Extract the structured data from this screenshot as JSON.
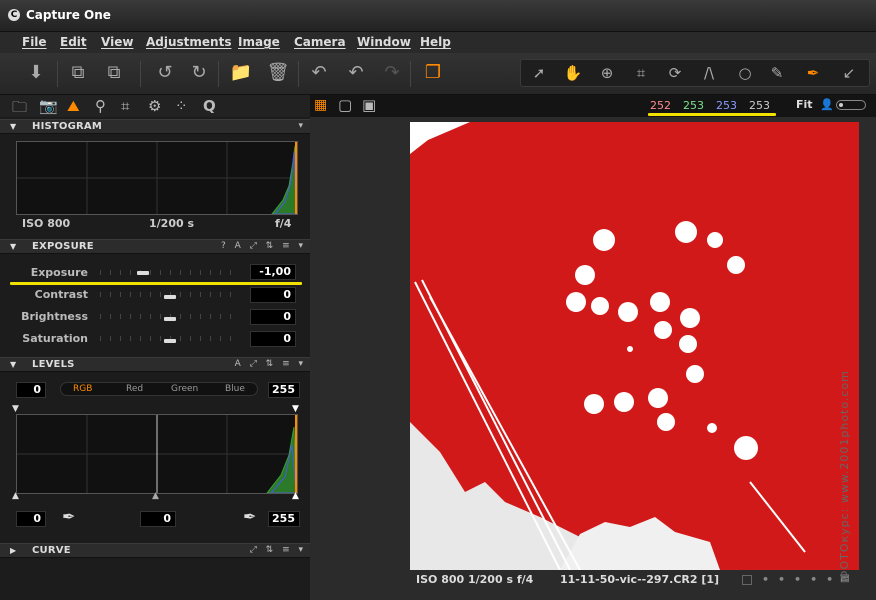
{
  "app": {
    "title": "Capture One",
    "logo_glyph": "C"
  },
  "menu": [
    "File",
    "Edit",
    "View",
    "Adjustments",
    "Image",
    "Camera",
    "Window",
    "Help"
  ],
  "toolbar": {
    "icons": [
      "import-icon",
      "compare-icon",
      "next-icon",
      "rotate-left-icon",
      "rotate-right-icon",
      "move-to-icon",
      "trash-icon",
      "undo-icon",
      "undo-step-icon",
      "redo-icon",
      "variants-icon"
    ],
    "cursor_tools": [
      "select-icon",
      "hand-icon",
      "zoom-icon",
      "crop-icon",
      "rotate-icon",
      "keystone-icon",
      "circle-icon",
      "brush-icon",
      "color-picker-icon",
      "white-balance-icon"
    ]
  },
  "tool_tabs": [
    "library-icon",
    "camera-icon",
    "exposure-icon",
    "details-icon",
    "crop-icon",
    "settings-icon",
    "metadata-icon",
    "quick-icon"
  ],
  "viewer": {
    "rgb": {
      "r": "252",
      "g": "253",
      "b": "253",
      "l": "253"
    },
    "zoom": "Fit",
    "status": {
      "exif": "ISO 800 1/200 s f/4",
      "file": "11-11-50-vic--297.CR2 [1]"
    },
    "watermark": "ФОТОкурс: www.2001photo.com"
  },
  "histogram": {
    "label": "HISTOGRAM",
    "iso": "ISO 800",
    "shutter": "1/200 s",
    "aperture": "f/4"
  },
  "exposure": {
    "label": "EXPOSURE",
    "controls": "? A ⤢ ⇅ ≡ ▾",
    "rows": [
      {
        "label": "Exposure",
        "value": "-1,00",
        "pos": 0.33
      },
      {
        "label": "Contrast",
        "value": "0",
        "pos": 0.5
      },
      {
        "label": "Brightness",
        "value": "0",
        "pos": 0.5
      },
      {
        "label": "Saturation",
        "value": "0",
        "pos": 0.5
      }
    ]
  },
  "levels": {
    "label": "LEVELS",
    "controls": "A ⤢ ⇅ ≡ ▾",
    "input_low": "0",
    "input_high": "255",
    "channels": [
      "RGB",
      "Red",
      "Green",
      "Blue"
    ],
    "output_low": "0",
    "output_mid": "0",
    "output_high": "255"
  },
  "curve": {
    "label": "CURVE",
    "controls": "⤢ ⇅ ≡ ▾"
  },
  "colors": {
    "accent": "#ff8a00",
    "highlight": "#f2e200",
    "photo_red": "#d11919"
  }
}
